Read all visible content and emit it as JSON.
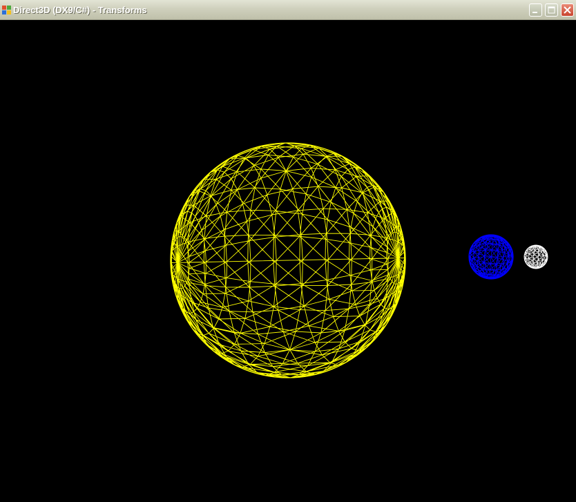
{
  "window": {
    "title": "Direct3D (DX9/C#) - Transforms",
    "icon": "windows-app-icon",
    "controls": [
      "minimize-icon",
      "maximize-icon",
      "close-icon"
    ]
  },
  "scene": {
    "background_color": "#000000",
    "render_mode": "wireframe",
    "bodies": [
      {
        "name": "sun",
        "color": "#ffff00"
      },
      {
        "name": "earth",
        "color": "#0000ff"
      },
      {
        "name": "moon",
        "color": "#ffffff"
      }
    ]
  }
}
